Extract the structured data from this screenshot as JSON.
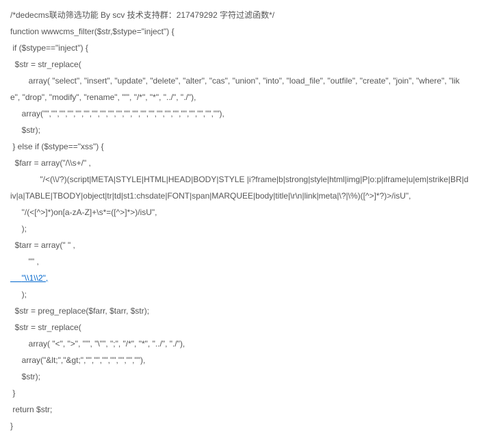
{
  "lines": [
    {
      "text": "/*dedecms联动筛选功能 By scv 技术支持群：217479292 字符过滤函数*/",
      "indent": 0,
      "link": false
    },
    {
      "text": "function wwwcms_filter($str,$stype=\"inject\") {",
      "indent": 0,
      "link": false
    },
    {
      "text": " if ($stype==\"inject\") {",
      "indent": 0,
      "link": false
    },
    {
      "text": "  $str = str_replace(",
      "indent": 0,
      "link": false
    },
    {
      "text": "        array( \"select\", \"insert\", \"update\", \"delete\", \"alter\", \"cas\", \"union\", \"into\", \"load_file\", \"outfile\", \"create\", \"join\", \"where\", \"like\", \"drop\", \"modify\", \"rename\", \"'\", \"/*\", \"*\", \"../\", \"./\"),",
      "indent": 0,
      "link": false
    },
    {
      "text": "     array(\"\",\"\",\"\",\"\",\"\",\"\",\"\",\"\",\"\",\"\",\"\",\"\",\"\",\"\",\"\",\"\",\"\",\"\",\"\",\"\",\"\",\"\"),",
      "indent": 0,
      "link": false
    },
    {
      "text": "     $str);",
      "indent": 0,
      "link": false
    },
    {
      "text": " } else if ($stype==\"xss\") {",
      "indent": 0,
      "link": false
    },
    {
      "text": "  $farr = array(\"/\\\\s+/\" ,",
      "indent": 0,
      "link": false
    },
    {
      "text": "             \"/<(\\\\/?)(script|META|STYLE|HTML|HEAD|BODY|STYLE |i?frame|b|strong|style|html|img|P|o:p|iframe|u|em|strike|BR|div|a|TABLE|TBODY|object|tr|td|st1:chsdate|FONT|span|MARQUEE|body|title|\\r\\n|link|meta|\\?|\\%)([^>]*?)>/isU\",",
      "indent": 0,
      "link": false
    },
    {
      "text": "     \"/(<[^>]*)on[a-zA-Z]+\\s*=([^>]*>)/isU\",",
      "indent": 0,
      "link": false
    },
    {
      "text": "     );",
      "indent": 0,
      "link": false
    },
    {
      "text": "  $tarr = array(\" \" ,",
      "indent": 0,
      "link": false
    },
    {
      "text": "        \"\" ,",
      "indent": 0,
      "link": false
    },
    {
      "text": "     \"\\\\1\\\\2\",",
      "indent": 0,
      "link": true
    },
    {
      "text": "     );",
      "indent": 0,
      "link": false
    },
    {
      "text": "  $str = preg_replace($farr, $tarr, $str);",
      "indent": 0,
      "link": false
    },
    {
      "text": "  $str = str_replace(",
      "indent": 0,
      "link": false
    },
    {
      "text": "        array( \"<\", \">\", \"'\", \"\\\"\", \";\", \"/*\", \"*\", \"../\", \"./\"),",
      "indent": 0,
      "link": false
    },
    {
      "text": "     array(\"&lt;\",\"&gt;\",\"\",\"\",\"\",\"\",\"\",\"\",\"\"),",
      "indent": 0,
      "link": false
    },
    {
      "text": "     $str);",
      "indent": 0,
      "link": false
    },
    {
      "text": " }",
      "indent": 0,
      "link": false
    },
    {
      "text": " return $str;",
      "indent": 0,
      "link": false
    },
    {
      "text": "}",
      "indent": 0,
      "link": false
    }
  ]
}
